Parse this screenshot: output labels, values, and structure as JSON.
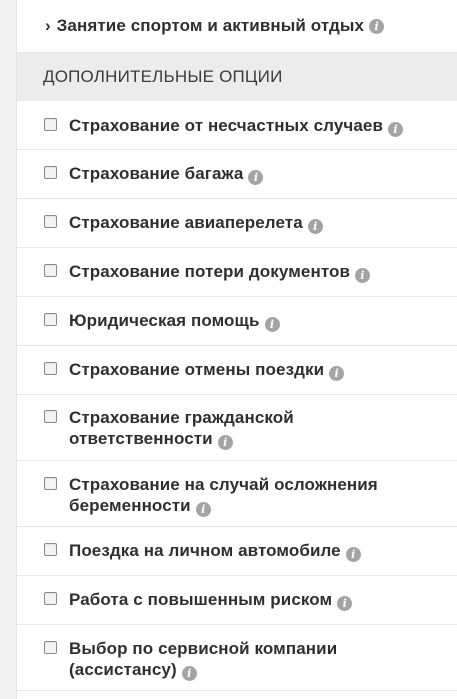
{
  "sport_row": {
    "chevron": "›",
    "label": "Занятие спортом и активный отдых"
  },
  "section_header": "ДОПОЛНИТЕЛЬНЫЕ ОПЦИИ",
  "options": [
    {
      "label": "Страхование от несчастных случаев",
      "checked": false
    },
    {
      "label": "Страхование багажа",
      "checked": false
    },
    {
      "label": "Страхование авиаперелета",
      "checked": false
    },
    {
      "label": "Страхование потери документов",
      "checked": false
    },
    {
      "label": "Юридическая помощь",
      "checked": false
    },
    {
      "label": "Страхование отмены поездки",
      "checked": false
    },
    {
      "label": "Страхование гражданской ответственности",
      "checked": false
    },
    {
      "label": "Страхование на случай осложнения беременности",
      "checked": false
    },
    {
      "label": "Поездка на личном автомобиле",
      "checked": false
    },
    {
      "label": "Работа с повышенным риском",
      "checked": false
    },
    {
      "label": "Выбор по сервисной компании (ассистансу)",
      "checked": false
    }
  ],
  "info_icon_glyph": "i",
  "colors": {
    "section_bg": "#ececec",
    "info_icon": "#a4a4a4",
    "text": "#2f2f2f"
  }
}
